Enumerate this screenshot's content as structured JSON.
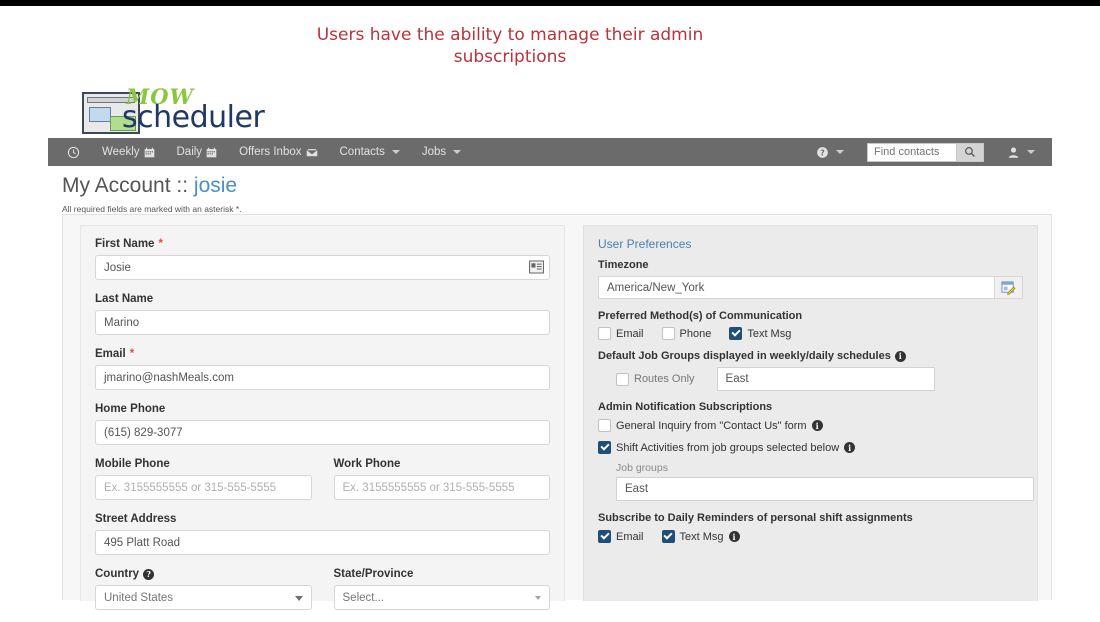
{
  "annotation": {
    "text": "Users have the ability to manage their admin subscriptions",
    "color": "#b7343a"
  },
  "logo": {
    "top_word": "MOW",
    "bottom_word": "scheduler",
    "top_color": "#8cc63e",
    "bottom_color": "#1f3864"
  },
  "navbar": {
    "background": "#6b6b6b",
    "items": [
      {
        "label": "",
        "icon": "clock-icon",
        "caret": false
      },
      {
        "label": "Weekly",
        "icon": "calendar-icon",
        "caret": false
      },
      {
        "label": "Daily",
        "icon": "calendar-icon",
        "caret": false
      },
      {
        "label": "Offers Inbox",
        "icon": "inbox-icon",
        "caret": false
      },
      {
        "label": "Contacts",
        "icon": "",
        "caret": true
      },
      {
        "label": "Jobs",
        "icon": "",
        "caret": true
      }
    ],
    "help_icon": "question-circle-icon",
    "user_icon": "user-icon",
    "search": {
      "placeholder": "Find contacts",
      "value": "",
      "button_icon": "search-icon"
    }
  },
  "page": {
    "title_prefix": "My Account ::",
    "title_user": "josie",
    "required_note": "All required fields are marked with an asterisk *.",
    "user_color": "#4a90c4"
  },
  "form": {
    "first_name": {
      "label": "First Name",
      "required": "*",
      "value": "Josie",
      "icon": "contact-card-icon"
    },
    "last_name": {
      "label": "Last Name",
      "value": "Marino"
    },
    "email": {
      "label": "Email",
      "required": "*",
      "value": "jmarino@nashMeals.com"
    },
    "home_phone": {
      "label": "Home Phone",
      "value": "(615) 829-3077"
    },
    "mobile_phone": {
      "label": "Mobile Phone",
      "value": "",
      "placeholder": "Ex. 3155555555 or 315-555-5555"
    },
    "work_phone": {
      "label": "Work Phone",
      "value": "",
      "placeholder": "Ex. 3155555555 or 315-555-5555"
    },
    "street_address": {
      "label": "Street Address",
      "value": "495 Platt Road"
    },
    "country": {
      "label": "Country",
      "value": "United States",
      "info_icon": "help-circle-icon"
    },
    "state": {
      "label": "State/Province",
      "value": "Select..."
    }
  },
  "prefs": {
    "title": "User Preferences",
    "timezone": {
      "label": "Timezone",
      "value": "America/New_York",
      "edit_icon": "edit-form-icon"
    },
    "communication": {
      "label": "Preferred Method(s) of Communication",
      "options": [
        {
          "label": "Email",
          "checked": false
        },
        {
          "label": "Phone",
          "checked": false
        },
        {
          "label": "Text Msg",
          "checked": true
        }
      ]
    },
    "default_job_groups": {
      "label": "Default Job Groups displayed in weekly/daily schedules",
      "info_icon": "info-icon",
      "routes_only": {
        "label": "Routes Only",
        "checked": false
      },
      "select_value": "East"
    },
    "admin_subscriptions": {
      "label": "Admin Notification Subscriptions",
      "items": [
        {
          "label": "General Inquiry from \"Contact Us\" form",
          "checked": false,
          "info_icon": "info-icon"
        },
        {
          "label": "Shift Activities from job groups selected below",
          "checked": true,
          "info_icon": "info-icon"
        }
      ],
      "job_groups_label": "Job groups",
      "job_groups_value": "East"
    },
    "daily_reminders": {
      "label": "Subscribe to Daily Reminders of personal shift assignments",
      "options": [
        {
          "label": "Email",
          "checked": true
        },
        {
          "label": "Text Msg",
          "checked": true
        }
      ],
      "info_icon": "info-icon"
    },
    "checked_color": "#1f4e79"
  }
}
